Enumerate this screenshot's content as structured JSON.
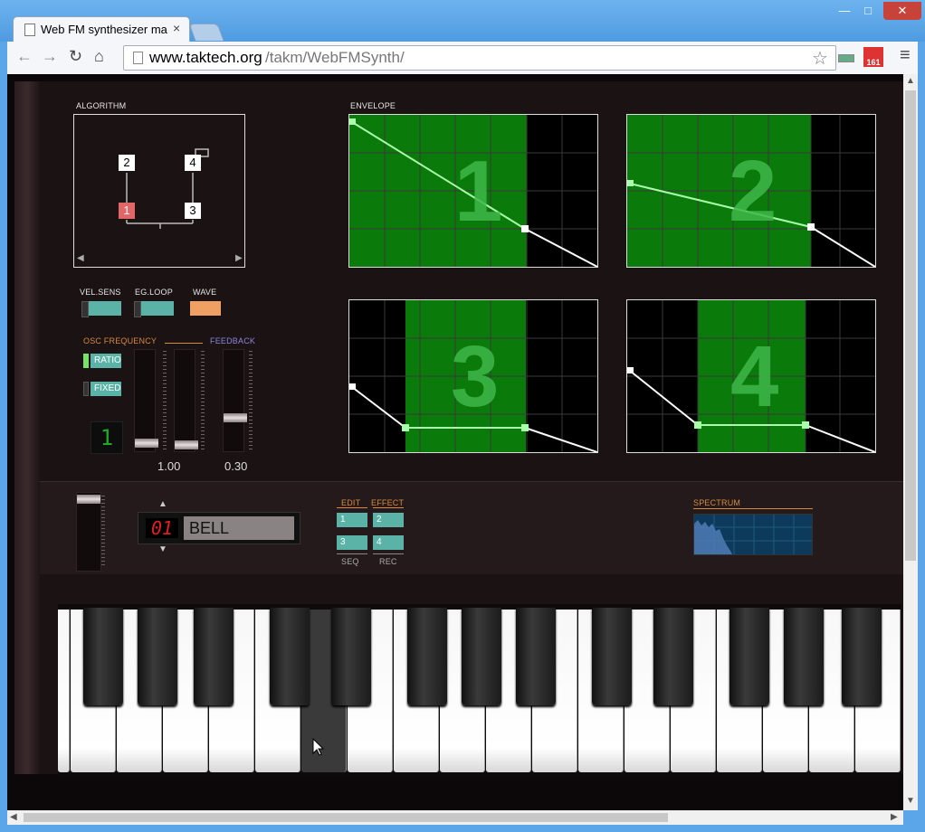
{
  "browser": {
    "tab_title": "Web FM synthesizer ma",
    "tab_close": "×",
    "url_host": "www.taktech.org",
    "url_path": "/takm/WebFMSynth/",
    "nav": {
      "back": "←",
      "forward": "→",
      "reload": "↻",
      "home": "⌂",
      "star": "☆",
      "menu": "≡"
    },
    "gmail_count": "161",
    "window": {
      "minimize": "—",
      "maximize": "□",
      "close": "✕"
    }
  },
  "synth": {
    "algorithm": {
      "label": "ALGORITHM",
      "operators": [
        "2",
        "4",
        "1",
        "3"
      ],
      "prev": "◀",
      "next": "▶"
    },
    "envelope": {
      "label": "ENVELOPE",
      "panels": [
        "1",
        "2",
        "3",
        "4"
      ]
    },
    "toggles": {
      "vel_sens": "VEL.SENS",
      "eg_loop": "EG.LOOP",
      "wave": "WAVE"
    },
    "osc": {
      "label": "OSC FREQUENCY",
      "feedback_label": "FEEDBACK",
      "ratio": "RATIO",
      "fixed": "FIXED",
      "operator_display": "1",
      "freq_value": "1.00",
      "feedback_value": "0.30"
    },
    "preset": {
      "number": "01",
      "name": "BELL",
      "up": "▲",
      "down": "▼"
    },
    "pads": {
      "edit_label": "EDIT",
      "effect_label": "EFFECT",
      "seq_label": "SEQ",
      "rec_label": "REC",
      "p1": "1",
      "p2": "2",
      "p3": "3",
      "p4": "4"
    },
    "spectrum": {
      "label": "SPECTRUM"
    }
  },
  "colors": {
    "active_env": "#0a7a0a",
    "pad": "#5bb3a8",
    "wave": "#f0a062",
    "carrier": "#e26666"
  }
}
